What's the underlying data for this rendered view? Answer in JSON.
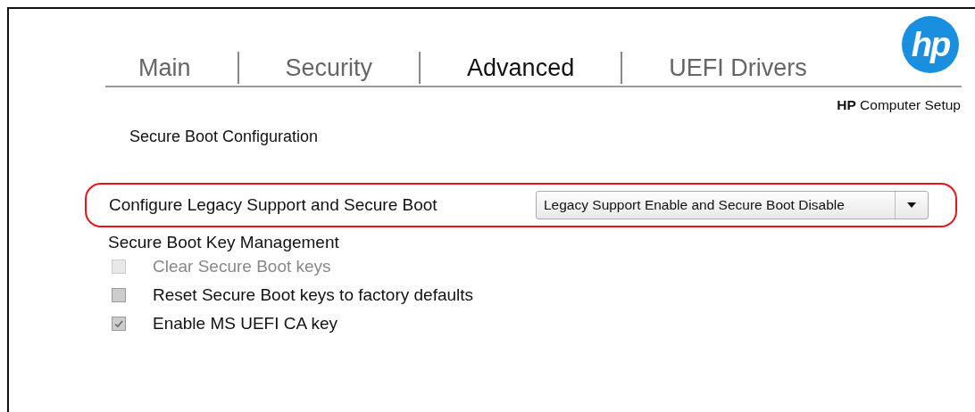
{
  "logo": {
    "text": "hp"
  },
  "tabs": [
    {
      "label": "Main",
      "selected": false
    },
    {
      "label": "Security",
      "selected": false
    },
    {
      "label": "Advanced",
      "selected": true
    },
    {
      "label": "UEFI Drivers",
      "selected": false
    }
  ],
  "subtitle": "**HP** Computer Setup",
  "section_title": "Secure Boot Configuration",
  "setting": {
    "label": "Configure Legacy Support and Secure Boot",
    "value": "Legacy Support Enable and Secure Boot Disable",
    "highlighted": true
  },
  "key_management": {
    "title": "Secure Boot Key Management",
    "options": [
      {
        "label": "Clear Secure Boot keys",
        "checked": false,
        "disabled": true
      },
      {
        "label": "Reset Secure Boot keys to factory defaults",
        "checked": false,
        "disabled": false
      },
      {
        "label": "Enable MS UEFI CA key",
        "checked": true,
        "disabled": false
      }
    ]
  }
}
